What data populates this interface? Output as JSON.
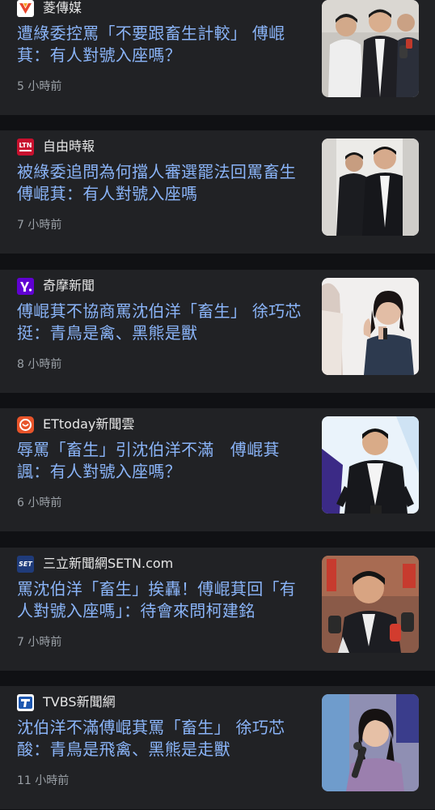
{
  "articles": [
    {
      "source": "菱傳媒",
      "logo_icon": "mirror-media-logo-icon",
      "headline": "遭綠委控罵「不要跟畜生計較」 傅崐萁：有人對號入座嗎？",
      "time": "5 小時前"
    },
    {
      "source": "自由時報",
      "logo_icon": "ltn-logo-icon",
      "headline": "被綠委追問為何擋人審選罷法回罵畜生 傅崐萁：有人對號入座嗎",
      "time": "7 小時前"
    },
    {
      "source": "奇摩新聞",
      "logo_icon": "yahoo-logo-icon",
      "headline": "傅崐萁不協商罵沈伯洋「畜生」 徐巧芯挺：青鳥是禽、黑熊是獸",
      "time": "8 小時前"
    },
    {
      "source": "ETtoday新聞雲",
      "logo_icon": "ettoday-logo-icon",
      "headline": "辱罵「畜生」引沈伯洋不滿　傅崐萁諷：有人對號入座嗎？",
      "time": "6 小時前"
    },
    {
      "source": "三立新聞網SETN.com",
      "logo_icon": "setn-logo-icon",
      "headline": "罵沈伯洋「畜生」挨轟！傅崐萁回「有人對號入座嗎」：待會來問柯建銘",
      "time": "7 小時前"
    },
    {
      "source": "TVBS新聞網",
      "logo_icon": "tvbs-logo-icon",
      "headline": "沈伯洋不滿傅崐萁罵「畜生」 徐巧芯酸：青鳥是飛禽、黑熊是走獸",
      "time": "11 小時前"
    }
  ],
  "logo_texts": {
    "ltn": "LTN",
    "set": "SET"
  }
}
